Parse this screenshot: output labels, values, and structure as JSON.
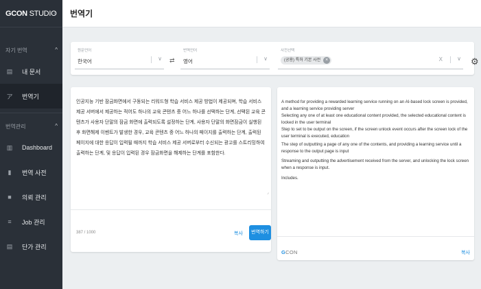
{
  "sidebar": {
    "logo_prefix": "GCON",
    "logo_suffix": " STUDIO",
    "collapse_glyph": "‹",
    "sections": [
      {
        "label": "자기 번역",
        "chevron": "^"
      },
      {
        "label": "번역관리",
        "chevron": "^"
      }
    ],
    "items": [
      {
        "label": "내 문서",
        "icon": "document-icon",
        "glyph": "▤"
      },
      {
        "label": "번역기",
        "icon": "translate-icon",
        "glyph": "ア"
      },
      {
        "label": "Dashboard",
        "icon": "dashboard-icon",
        "glyph": "▥"
      },
      {
        "label": "번역 사전",
        "icon": "dictionary-icon",
        "glyph": "▮"
      },
      {
        "label": "의뢰 관리",
        "icon": "request-icon",
        "glyph": "■"
      },
      {
        "label": "Job 관리",
        "icon": "list-icon",
        "glyph": "≡"
      },
      {
        "label": "단가 관리",
        "icon": "price-icon",
        "glyph": "▤"
      }
    ]
  },
  "header": {
    "title": "번역기"
  },
  "langbar": {
    "source": {
      "label": "원문언어",
      "value": "한국어"
    },
    "swap_glyph": "⇄",
    "target": {
      "label": "번역언어",
      "value": "영어"
    },
    "dictionary": {
      "label": "사전선택",
      "chip": "(공용) 특허 기본 사전",
      "clear": "X"
    },
    "settings_glyph": "⚙"
  },
  "source_panel": {
    "text": "인공지능 기반 잠금화면에서 구동되는 리워드형 학습 서비스 제공 방법이 제공되며, 학습 서비스 제공 서버에서 제공하는 적어도 하나의 교육 콘텐츠 중 어느 하나를 선택하는 단계, 선택된 교육 콘텐츠가 사용자 단말의 잠금 화면에 출력되도록 설정하는 단계, 사용자 단말의 화면잠금이 실행된 후 화면해제 이벤트가 발생한 경우, 교육 콘텐츠 중 어느 하나의 페이지를 출력하는 단계, 출력된 페이지에 대한 응답이 입력될 때까지 학습 서비스 제공 서버로부터 수신되는 광고를 스트리밍하여 출력하는 단계, 및 응답이 입력된 경우 잠금화면을 해제하는 단계를 포함한다.",
    "resize_glyph": "⌟",
    "count": "387 / 1000",
    "copy_label": "복사",
    "translate_label": "번역하기"
  },
  "target_panel": {
    "lines": [
      "A method for providing a rewarded learning service running on an AI-based lock screen is provided, and a learning service providing server",
      "Selecting any one of at least one educational content provided, the selected educational content is locked in the user terminal",
      "Step to set to be output on the screen, if the screen unlock event occurs after the screen lock of the user terminal is executed, education",
      "The step of outputting a page of any one of the contents, and providing a learning service until a response to the output page is input",
      "Streaming and outputting the advertisement received from the server, and unlocking the lock screen when a response is input.",
      "Includes."
    ],
    "footer_prefix": "G",
    "footer_suffix": "CON",
    "copy_label": "복사"
  }
}
